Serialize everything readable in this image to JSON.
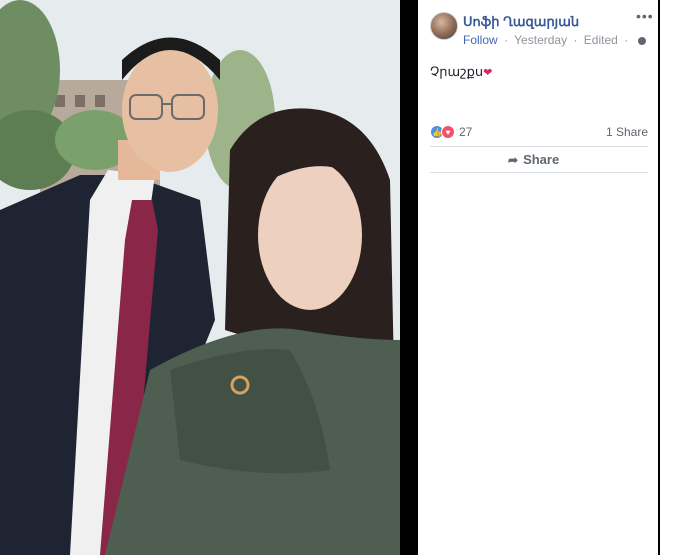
{
  "post": {
    "author_name": "Սոֆի Ղազարյան",
    "follow_label": "Follow",
    "separator": "·",
    "timestamp": "Yesterday",
    "edited_label": "Edited",
    "text": "Չրաշքս",
    "reaction_count": "27",
    "share_count": "1 Share",
    "share_button_label": "Share"
  },
  "icons": {
    "like": "like-reaction-icon",
    "love": "love-reaction-icon",
    "globe": "globe-icon",
    "share": "share-arrow-icon",
    "more": "more-options-icon"
  },
  "colors": {
    "name_link": "#385898",
    "follow_link": "#4267b2",
    "meta_text": "#90949c",
    "love": "#f25268",
    "like": "#4a90e2"
  }
}
